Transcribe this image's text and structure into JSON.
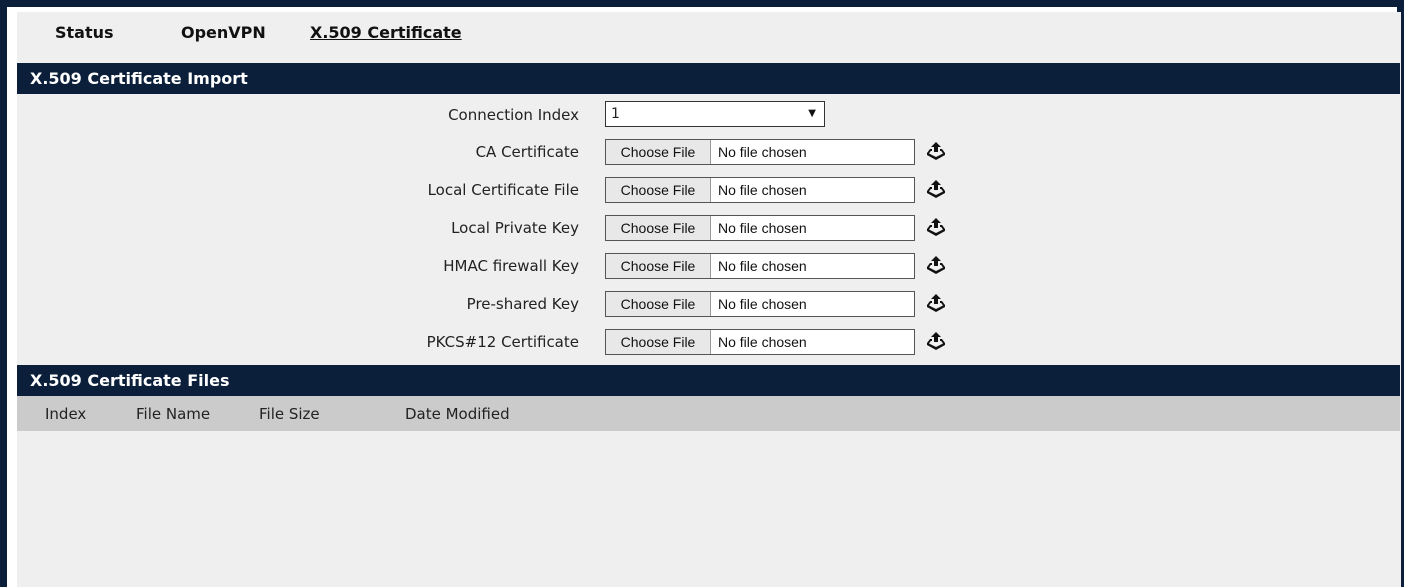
{
  "tabs": [
    {
      "label": "Status",
      "active": false
    },
    {
      "label": "OpenVPN",
      "active": false
    },
    {
      "label": "X.509 Certificate",
      "active": true
    }
  ],
  "import_section": {
    "title": "X.509 Certificate Import",
    "connection_index": {
      "label": "Connection Index",
      "value": "1"
    },
    "file_rows": [
      {
        "label": "CA Certificate",
        "button": "Choose File",
        "status": "No file chosen"
      },
      {
        "label": "Local Certificate File",
        "button": "Choose File",
        "status": "No file chosen"
      },
      {
        "label": "Local Private Key",
        "button": "Choose File",
        "status": "No file chosen"
      },
      {
        "label": "HMAC firewall Key",
        "button": "Choose File",
        "status": "No file chosen"
      },
      {
        "label": "Pre-shared Key",
        "button": "Choose File",
        "status": "No file chosen"
      },
      {
        "label": "PKCS#12 Certificate",
        "button": "Choose File",
        "status": "No file chosen"
      }
    ],
    "upload_icon": "upload-icon"
  },
  "files_section": {
    "title": "X.509 Certificate Files",
    "columns": [
      "Index",
      "File Name",
      "File Size",
      "Date Modified"
    ],
    "rows": []
  },
  "colors": {
    "header_bar": "#0b1f3a",
    "panel_bg": "#efefef",
    "table_header_bg": "#cbcbcb"
  }
}
